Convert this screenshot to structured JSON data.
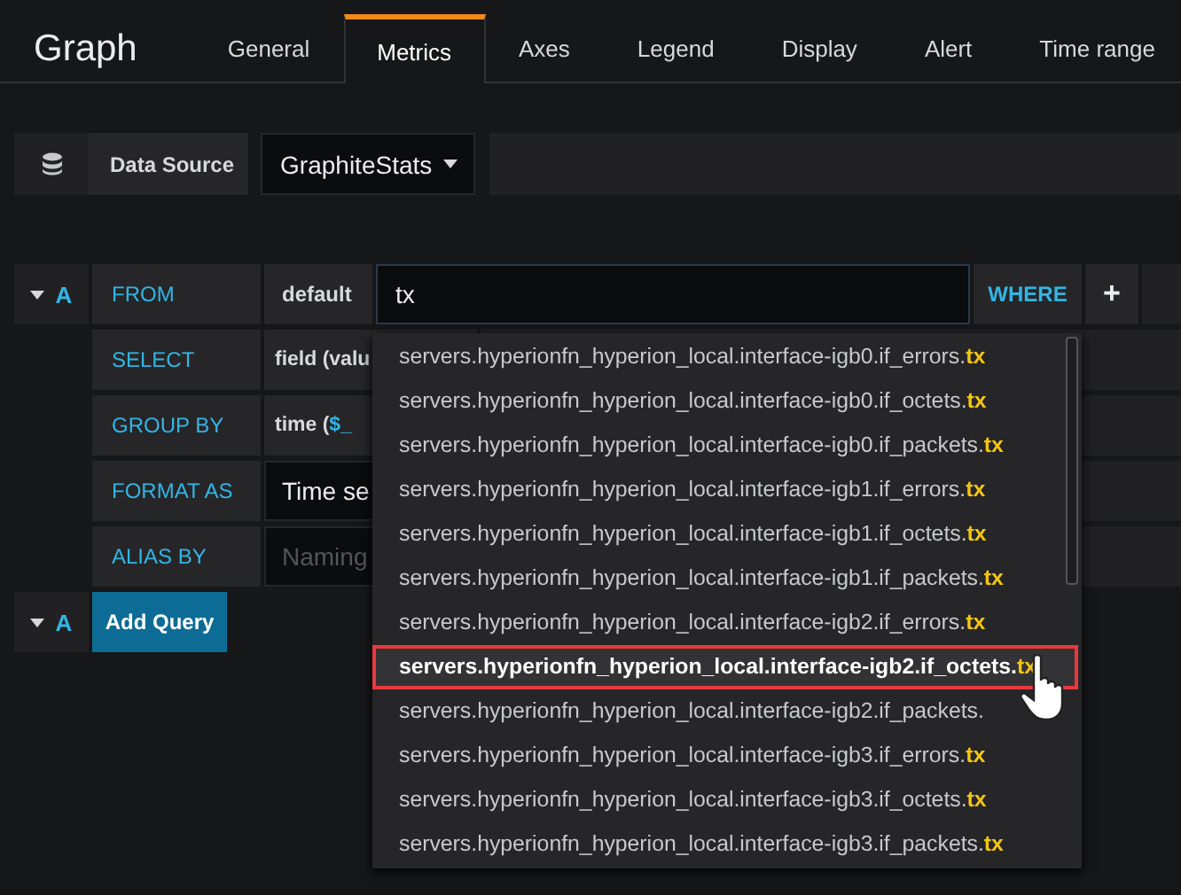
{
  "panel_title": "Graph",
  "tabs": [
    {
      "label": "General",
      "selected": false
    },
    {
      "label": "Metrics",
      "selected": true
    },
    {
      "label": "Axes",
      "selected": false
    },
    {
      "label": "Legend",
      "selected": false
    },
    {
      "label": "Display",
      "selected": false
    },
    {
      "label": "Alert",
      "selected": false
    },
    {
      "label": "Time range",
      "selected": false
    }
  ],
  "data_source": {
    "label": "Data Source",
    "value": "GraphiteStats"
  },
  "query": {
    "ref": "A",
    "expanded": true,
    "from": {
      "label": "FROM",
      "policy": "default",
      "value": "tx",
      "where": "WHERE",
      "add": "+"
    },
    "rows": [
      {
        "kind": "text",
        "label": "SELECT",
        "value": "field (valu"
      },
      {
        "kind": "macro",
        "label": "GROUP BY",
        "value": "time (",
        "param": "$_"
      },
      {
        "kind": "input",
        "label": "FORMAT AS",
        "value": "Time se"
      },
      {
        "kind": "placeholder",
        "label": "ALIAS BY",
        "placeholder": "Naming"
      }
    ]
  },
  "add_query": {
    "ref": "A",
    "expanded": true,
    "button": "Add Query"
  },
  "suggestions": [
    {
      "text": "servers.hyperionfn_hyperion_local.interface-igb0.if_errors.",
      "match": "tx",
      "selected": false
    },
    {
      "text": "servers.hyperionfn_hyperion_local.interface-igb0.if_octets.",
      "match": "tx",
      "selected": false
    },
    {
      "text": "servers.hyperionfn_hyperion_local.interface-igb0.if_packets.",
      "match": "tx",
      "selected": false
    },
    {
      "text": "servers.hyperionfn_hyperion_local.interface-igb1.if_errors.",
      "match": "tx",
      "selected": false
    },
    {
      "text": "servers.hyperionfn_hyperion_local.interface-igb1.if_octets.",
      "match": "tx",
      "selected": false
    },
    {
      "text": "servers.hyperionfn_hyperion_local.interface-igb1.if_packets.",
      "match": "tx",
      "selected": false
    },
    {
      "text": "servers.hyperionfn_hyperion_local.interface-igb2.if_errors.",
      "match": "tx",
      "selected": false
    },
    {
      "text": "servers.hyperionfn_hyperion_local.interface-igb2.if_octets.",
      "match": "tx",
      "selected": true
    },
    {
      "text": "servers.hyperionfn_hyperion_local.interface-igb2.if_packets.",
      "selected": false
    },
    {
      "text": "servers.hyperionfn_hyperion_local.interface-igb3.if_errors.",
      "match": "tx",
      "selected": false
    },
    {
      "text": "servers.hyperionfn_hyperion_local.interface-igb3.if_octets.",
      "match": "tx",
      "selected": false
    },
    {
      "text": "servers.hyperionfn_hyperion_local.interface-igb3.if_packets.",
      "match": "tx",
      "selected": false
    }
  ]
}
